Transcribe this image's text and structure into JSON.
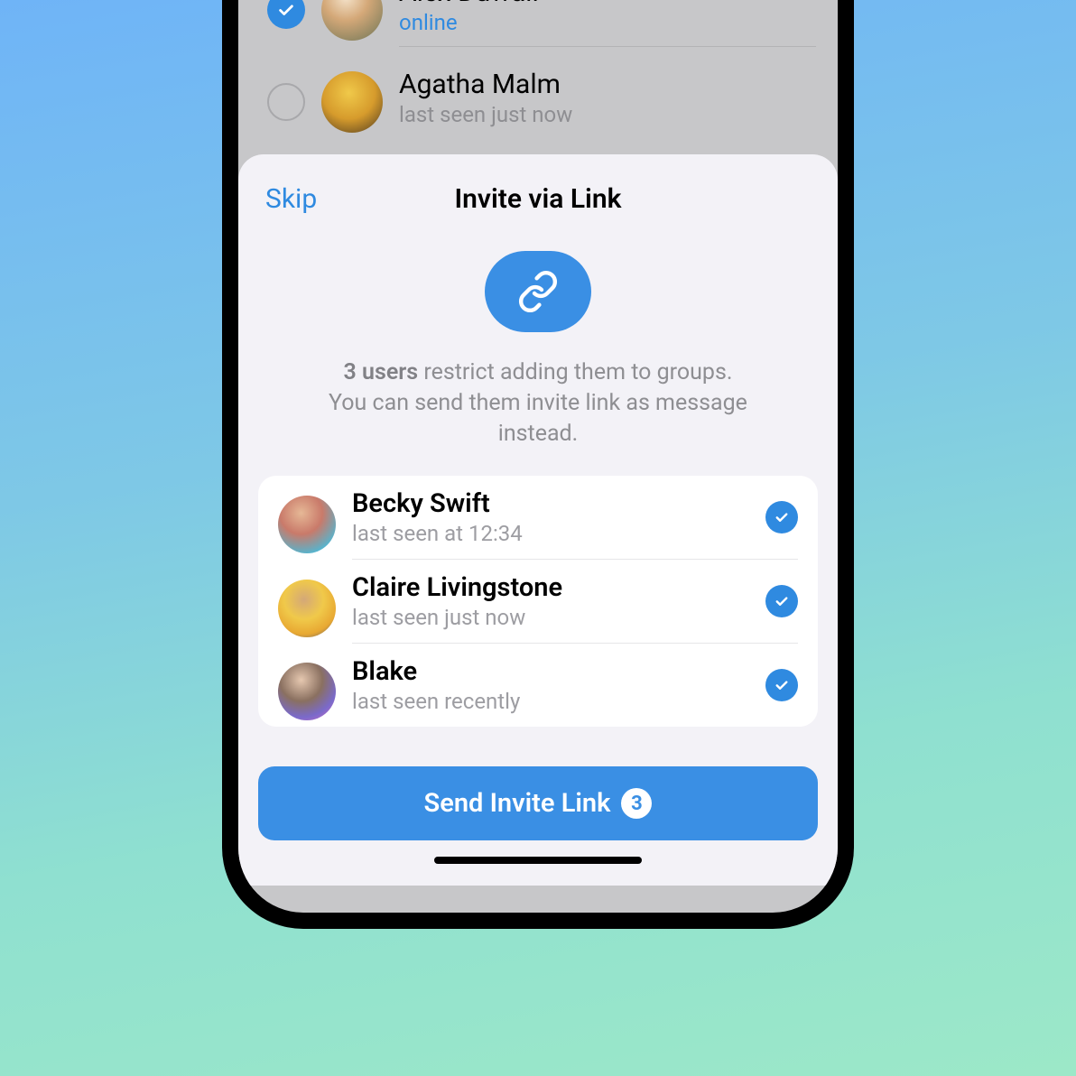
{
  "background_contacts": [
    {
      "name": "Alex Duwall",
      "status": "online",
      "online": true,
      "selected": true
    },
    {
      "name": "Agatha Malm",
      "status": "last seen just now",
      "online": false,
      "selected": false
    }
  ],
  "sheet": {
    "skip_label": "Skip",
    "title": "Invite via Link",
    "info_bold": "3 users",
    "info_text_1": " restrict adding them to groups.",
    "info_text_2": "You can send them invite link as message instead."
  },
  "invite_contacts": [
    {
      "name": "Becky Swift",
      "status": "last seen at 12:34",
      "selected": true
    },
    {
      "name": "Claire Livingstone",
      "status": "last seen just now",
      "selected": true
    },
    {
      "name": "Blake",
      "status": "last seen recently",
      "selected": true
    }
  ],
  "send_button": {
    "label": "Send Invite Link",
    "count": "3"
  },
  "colors": {
    "accent": "#3a8fe4"
  }
}
